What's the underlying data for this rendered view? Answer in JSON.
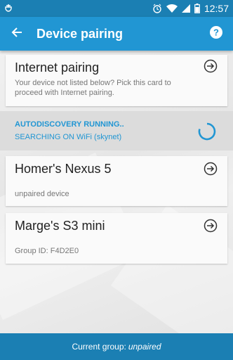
{
  "status_bar": {
    "time": "12:57"
  },
  "app_bar": {
    "title": "Device pairing"
  },
  "internet_card": {
    "title": "Internet pairing",
    "description": "Your device not listed below? Pick this card to proceed with Internet pairing."
  },
  "discovery": {
    "status": "AUTODISCOVERY RUNNING..",
    "detail": "SEARCHING ON WiFi (skynet)"
  },
  "devices": [
    {
      "name": "Homer's Nexus 5",
      "info": "unpaired device"
    },
    {
      "name": "Marge's S3 mini",
      "info": "Group ID: F4D2E0"
    }
  ],
  "footer": {
    "label": "Current group:",
    "value": "unpaired"
  },
  "colors": {
    "primary": "#2196d3",
    "primary_dark": "#1b7fb3"
  }
}
